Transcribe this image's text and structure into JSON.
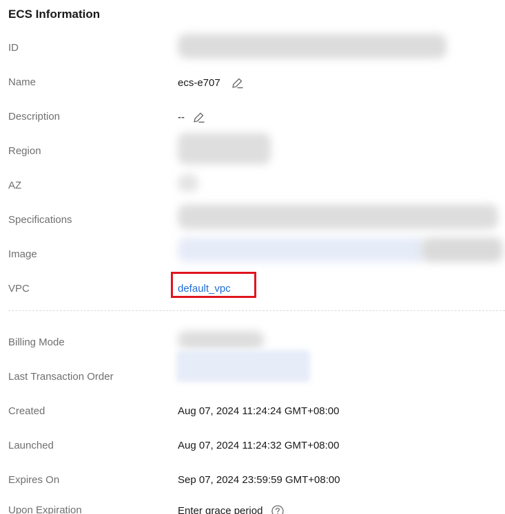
{
  "section": {
    "title": "ECS Information"
  },
  "rows": {
    "id": {
      "label": "ID"
    },
    "name": {
      "label": "Name",
      "value": "ecs-e707"
    },
    "description": {
      "label": "Description",
      "value": "--"
    },
    "region": {
      "label": "Region"
    },
    "az": {
      "label": "AZ"
    },
    "specifications": {
      "label": "Specifications"
    },
    "image": {
      "label": "Image"
    },
    "vpc": {
      "label": "VPC",
      "value": "default_vpc"
    },
    "billing_mode": {
      "label": "Billing Mode"
    },
    "last_transaction_order": {
      "label": "Last Transaction Order"
    },
    "created": {
      "label": "Created",
      "value": "Aug 07, 2024 11:24:24 GMT+08:00"
    },
    "launched": {
      "label": "Launched",
      "value": "Aug 07, 2024 11:24:32 GMT+08:00"
    },
    "expires_on": {
      "label": "Expires On",
      "value": "Sep 07, 2024 23:59:59 GMT+08:00"
    },
    "upon_expiration": {
      "label": "Upon Expiration",
      "value": "Enter grace period"
    }
  },
  "icons": {
    "edit": "pencil-icon",
    "help": "question-circle-icon"
  },
  "colors": {
    "link": "#1e6bd6",
    "highlight": "#e0141e",
    "label": "#6f6f6f",
    "value": "#191919"
  }
}
